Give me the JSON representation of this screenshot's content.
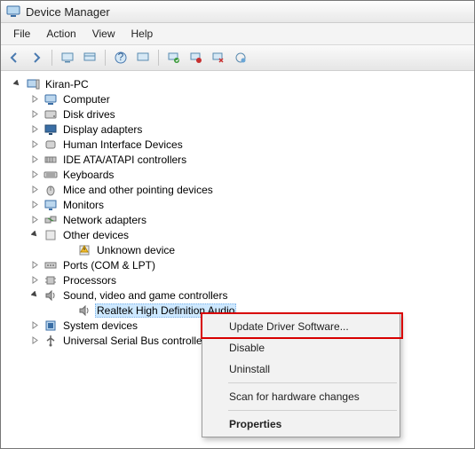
{
  "window": {
    "title": "Device Manager"
  },
  "menubar": [
    "File",
    "Action",
    "View",
    "Help"
  ],
  "tree": {
    "root": "Kiran-PC",
    "items": [
      {
        "label": "Computer",
        "expanded": false,
        "ico": "computer"
      },
      {
        "label": "Disk drives",
        "expanded": false,
        "ico": "disk"
      },
      {
        "label": "Display adapters",
        "expanded": false,
        "ico": "display"
      },
      {
        "label": "Human Interface Devices",
        "expanded": false,
        "ico": "hid"
      },
      {
        "label": "IDE ATA/ATAPI controllers",
        "expanded": false,
        "ico": "ide"
      },
      {
        "label": "Keyboards",
        "expanded": false,
        "ico": "keyboard"
      },
      {
        "label": "Mice and other pointing devices",
        "expanded": false,
        "ico": "mouse"
      },
      {
        "label": "Monitors",
        "expanded": false,
        "ico": "monitor"
      },
      {
        "label": "Network adapters",
        "expanded": false,
        "ico": "network"
      },
      {
        "label": "Other devices",
        "expanded": true,
        "ico": "other",
        "children": [
          {
            "label": "Unknown device",
            "ico": "warn"
          }
        ]
      },
      {
        "label": "Ports (COM & LPT)",
        "expanded": false,
        "ico": "port"
      },
      {
        "label": "Processors",
        "expanded": false,
        "ico": "cpu"
      },
      {
        "label": "Sound, video and game controllers",
        "expanded": true,
        "ico": "sound",
        "children": [
          {
            "label": "Realtek High Definition Audio",
            "ico": "sound",
            "selected": true
          }
        ]
      },
      {
        "label": "System devices",
        "expanded": false,
        "ico": "system"
      },
      {
        "label": "Universal Serial Bus controllers",
        "expanded": false,
        "ico": "usb"
      }
    ]
  },
  "context_menu": {
    "items": [
      {
        "label": "Update Driver Software...",
        "highlight": true
      },
      {
        "label": "Disable"
      },
      {
        "label": "Uninstall"
      },
      {
        "sep": true
      },
      {
        "label": "Scan for hardware changes"
      },
      {
        "sep": true
      },
      {
        "label": "Properties",
        "bold": true
      }
    ]
  },
  "toolbar_buttons": [
    "back",
    "forward",
    "sep",
    "screen1",
    "screen2",
    "sep",
    "help",
    "screen3",
    "sep",
    "screen-play",
    "monitor-check",
    "monitor-x",
    "gear-globe"
  ]
}
